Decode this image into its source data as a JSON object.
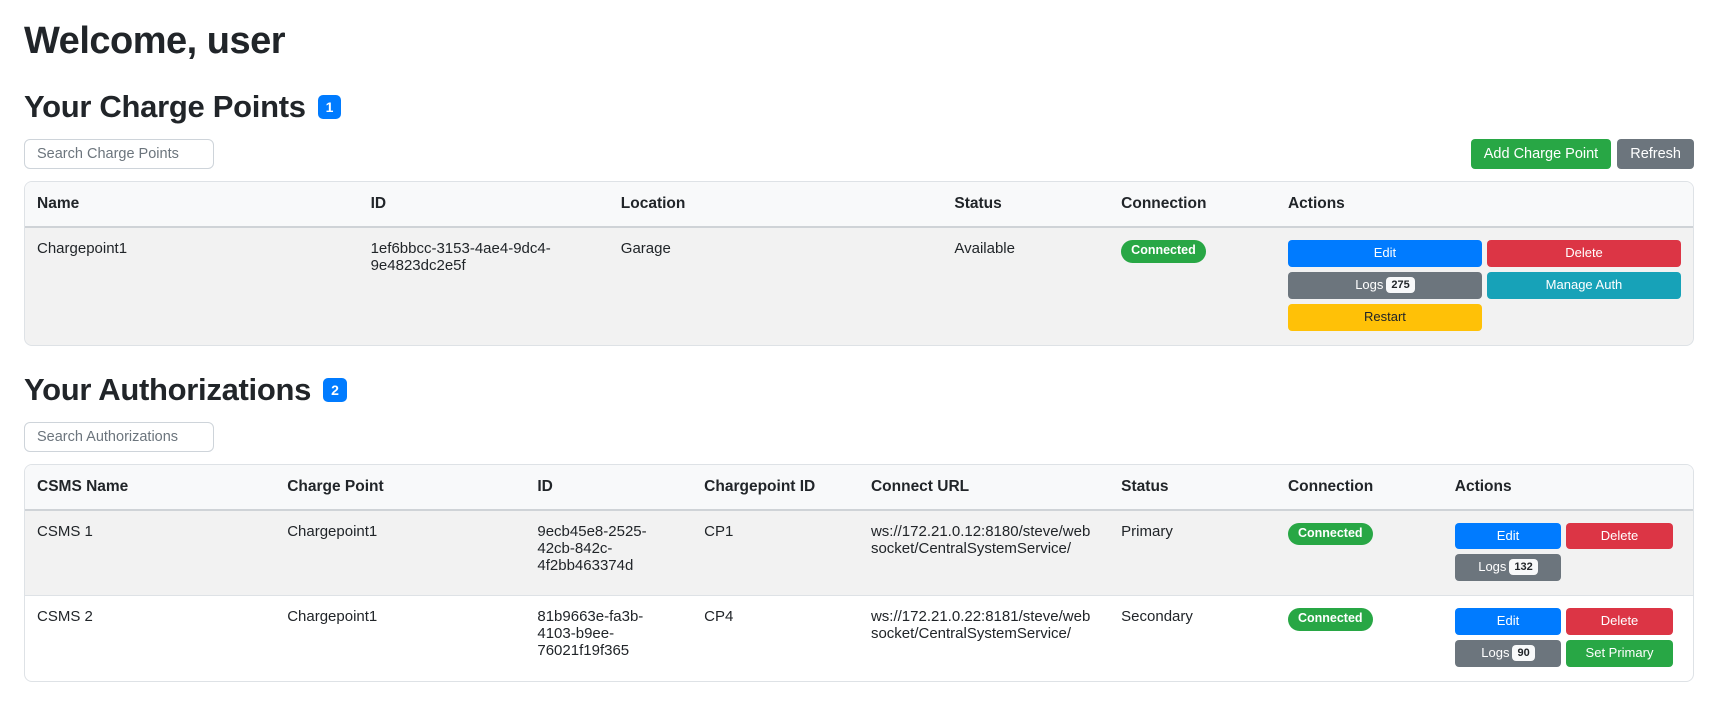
{
  "page": {
    "title": "Welcome, user"
  },
  "colors": {
    "primary_blue": "#007bff",
    "success_green": "#28a745",
    "danger_red": "#dc3545",
    "secondary_gray": "#6c757d",
    "info_teal": "#17a2b8",
    "warning_yellow": "#ffc107",
    "connected_badge_green": "#28a745",
    "text": "#212529",
    "table_border": "#dee2e6"
  },
  "charge_points_section": {
    "heading": "Your Charge Points",
    "count_badge": "1",
    "search_placeholder": "Search Charge Points",
    "add_button_label": "Add Charge Point",
    "refresh_button_label": "Refresh",
    "table": {
      "headers": [
        "Name",
        "ID",
        "Location",
        "Status",
        "Connection",
        "Actions"
      ],
      "rows": [
        {
          "name": "Chargepoint1",
          "id": "1ef6bbcc-3153-4ae4-9dc4-9e4823dc2e5f",
          "location": "Garage",
          "status": "Available",
          "connection": "Connected",
          "actions": {
            "edit": "Edit",
            "delete": "Delete",
            "logs": "Logs",
            "logs_count": "275",
            "manage_auth": "Manage Auth",
            "restart": "Restart"
          }
        }
      ]
    }
  },
  "authorizations_section": {
    "heading": "Your Authorizations",
    "count_badge": "2",
    "search_placeholder": "Search Authorizations",
    "table": {
      "headers": [
        "CSMS Name",
        "Charge Point",
        "ID",
        "Chargepoint ID",
        "Connect URL",
        "Status",
        "Connection",
        "Actions"
      ],
      "rows": [
        {
          "csms_name": "CSMS 1",
          "charge_point": "Chargepoint1",
          "id": "9ecb45e8-2525-42cb-842c-4f2bb463374d",
          "chargepoint_id": "CP1",
          "connect_url": "ws://172.21.0.12:8180/steve/websocket/CentralSystemService/",
          "status": "Primary",
          "connection": "Connected",
          "actions": {
            "edit": "Edit",
            "delete": "Delete",
            "logs": "Logs",
            "logs_count": "132"
          }
        },
        {
          "csms_name": "CSMS 2",
          "charge_point": "Chargepoint1",
          "id": "81b9663e-fa3b-4103-b9ee-76021f19f365",
          "chargepoint_id": "CP4",
          "connect_url": "ws://172.21.0.22:8181/steve/websocket/CentralSystemService/",
          "status": "Secondary",
          "connection": "Connected",
          "actions": {
            "edit": "Edit",
            "delete": "Delete",
            "logs": "Logs",
            "logs_count": "90",
            "set_primary": "Set Primary"
          }
        }
      ]
    }
  }
}
